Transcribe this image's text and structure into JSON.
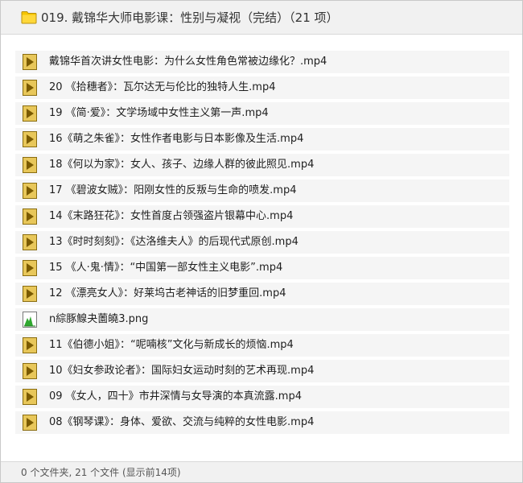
{
  "window": {
    "title": "019. 戴锦华大师电影课：性别与凝视（完结）（21 项）",
    "title_icon": "folder-icon"
  },
  "files": [
    {
      "name": "戴锦华首次讲女性电影：为什么女性角色常被边缘化？.mp4",
      "icon": "video-file-icon"
    },
    {
      "name": "20 《拾穗者》：瓦尔达无与伦比的独特人生.mp4",
      "icon": "video-file-icon"
    },
    {
      "name": "19 《简·爱》：文学场域中女性主义第一声.mp4",
      "icon": "video-file-icon"
    },
    {
      "name": "16《萌之朱雀》：女性作者电影与日本影像及生活.mp4",
      "icon": "video-file-icon"
    },
    {
      "name": "18《何以为家》：女人、孩子、边缘人群的彼此照见.mp4",
      "icon": "video-file-icon"
    },
    {
      "name": "17 《碧波女贼》：阳刚女性的反叛与生命的喷发.mp4",
      "icon": "video-file-icon"
    },
    {
      "name": "14《末路狂花》：女性首度占领强盗片银幕中心.mp4",
      "icon": "video-file-icon"
    },
    {
      "name": "13《时时刻刻》：《达洛维夫人》的后现代式原创.mp4",
      "icon": "video-file-icon"
    },
    {
      "name": "15 《人·鬼·情》：“中国第一部女性主义电影”.mp4",
      "icon": "video-file-icon"
    },
    {
      "name": "12 《漂亮女人》：好莱坞古老神话的旧梦重回.mp4",
      "icon": "video-file-icon"
    },
    {
      "name": "n綜豚鰁夬薗皢3.png",
      "icon": "image-file-icon"
    },
    {
      "name": "11《伯德小姐》：“呢喃核”文化与新成长的烦恼.mp4",
      "icon": "video-file-icon"
    },
    {
      "name": "10《妇女参政论者》：国际妇女运动时刻的艺术再现.mp4",
      "icon": "video-file-icon"
    },
    {
      "name": "09 《女人，四十》市井深情与女导演的本真流露.mp4",
      "icon": "video-file-icon"
    },
    {
      "name": "08《钢琴课》：身体、爱欲、交流与纯粹的女性电影.mp4",
      "icon": "video-file-icon"
    }
  ],
  "status": {
    "text": "0 个文件夹, 21 个文件 (显示前14项)"
  },
  "colors": {
    "titlebar_bg": "#f1f1f1",
    "row_bg": "#f5f5f5",
    "folder_yellow": "#f5c400",
    "video_icon_fill": "#e8c75a",
    "video_icon_border": "#8a6d10"
  }
}
